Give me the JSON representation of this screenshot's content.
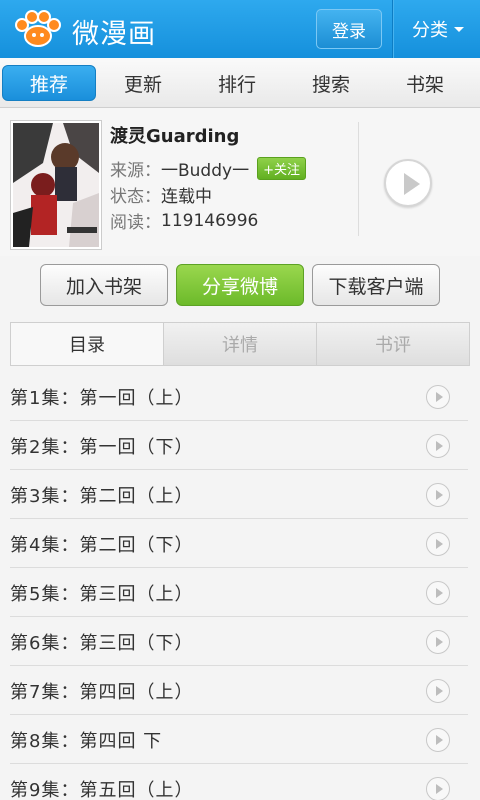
{
  "header": {
    "app_title": "微漫画",
    "login_label": "登录",
    "category_label": "分类",
    "logo_icon": "paw-logo-icon",
    "brand_color": "#1a94de"
  },
  "nav": {
    "tabs": [
      {
        "label": "推荐",
        "active": true
      },
      {
        "label": "更新",
        "active": false
      },
      {
        "label": "排行",
        "active": false
      },
      {
        "label": "搜索",
        "active": false
      },
      {
        "label": "书架",
        "active": false
      }
    ]
  },
  "book": {
    "title": "渡灵Guarding",
    "source_label": "来源：",
    "source_value": "一Buddy一",
    "follow_label": "+关注",
    "status_label": "状态：",
    "status_value": "连载中",
    "reads_label": "阅读：",
    "reads_value": "119146996"
  },
  "actions": {
    "add_shelf": "加入书架",
    "share_weibo": "分享微博",
    "download_client": "下载客户端"
  },
  "detail_tabs": [
    {
      "label": "目录",
      "active": true
    },
    {
      "label": "详情",
      "active": false
    },
    {
      "label": "书评",
      "active": false
    }
  ],
  "episodes": [
    "第1集：第一回（上）",
    "第2集：第一回（下）",
    "第3集：第二回（上）",
    "第4集：第二回（下）",
    "第5集：第三回（上）",
    "第6集：第三回（下）",
    "第7集：第四回（上）",
    "第8集：第四回 下",
    "第9集：第五回（上）"
  ]
}
